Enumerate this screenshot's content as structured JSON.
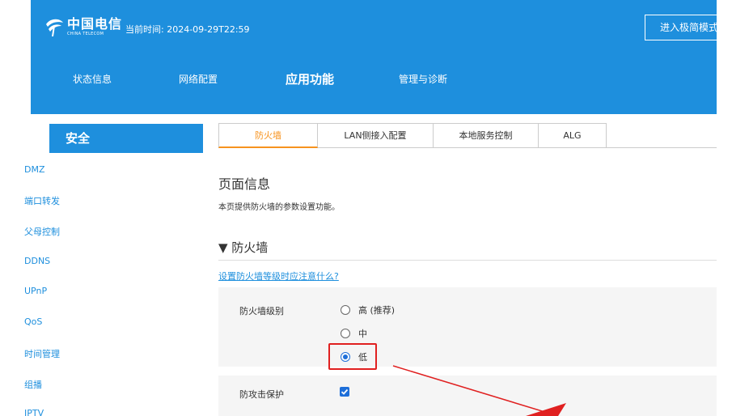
{
  "header": {
    "logo_cn": "中国电信",
    "logo_en": "CHINA TELECOM",
    "current_time": "当前时间: 2024-09-29T22:59",
    "simple_mode_button": "进入极简模式"
  },
  "main_nav": [
    {
      "label": "状态信息"
    },
    {
      "label": "网络配置"
    },
    {
      "label": "应用功能"
    },
    {
      "label": "管理与诊断"
    }
  ],
  "sidebar": {
    "title": "安全",
    "items": [
      {
        "label": "DMZ"
      },
      {
        "label": "端口转发"
      },
      {
        "label": "父母控制"
      },
      {
        "label": "DDNS"
      },
      {
        "label": "UPnP"
      },
      {
        "label": "QoS"
      },
      {
        "label": "时间管理"
      },
      {
        "label": "组播"
      },
      {
        "label": "IPTV"
      }
    ]
  },
  "tabs": [
    {
      "label": "防火墙"
    },
    {
      "label": "LAN侧接入配置"
    },
    {
      "label": "本地服务控制"
    },
    {
      "label": "ALG"
    }
  ],
  "page": {
    "title": "页面信息",
    "description": "本页提供防火墙的参数设置功能。",
    "section_title": "▼ 防火墙",
    "help_link": "设置防火墙等级时应注意什么?"
  },
  "form": {
    "level_label": "防火墙级别",
    "level_options": [
      {
        "label": "高 (推荐)"
      },
      {
        "label": "中"
      },
      {
        "label": "低"
      }
    ],
    "selected_level": "低",
    "attack_protect_label": "防攻击保护",
    "attack_protect_checked": true
  },
  "colors": {
    "brand_blue": "#1e8fdd",
    "tab_active": "#f7931e",
    "highlight_red": "#e02020"
  }
}
